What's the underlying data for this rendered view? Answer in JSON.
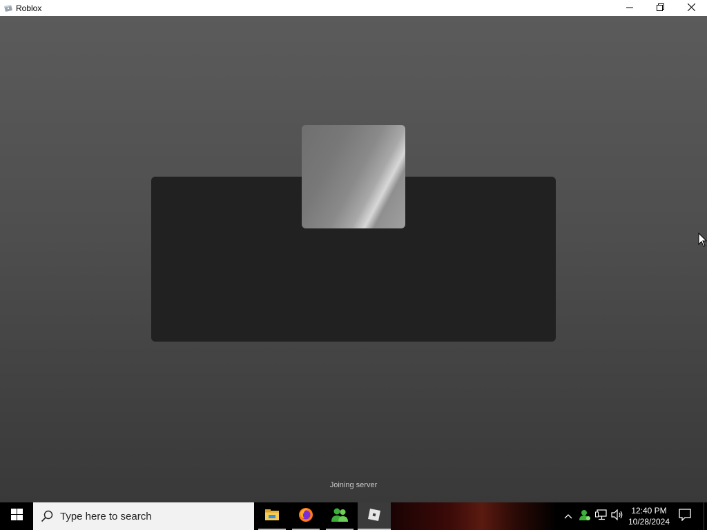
{
  "window": {
    "title": "Roblox",
    "icon": "roblox-window-icon",
    "controls": [
      "minimize-icon",
      "restore-icon",
      "close-icon"
    ]
  },
  "game": {
    "status": "Joining server",
    "thumbnail": "game-thumbnail-placeholder"
  },
  "taskbar": {
    "start_icon": "windows-logo-icon",
    "search_placeholder": "Type here to search",
    "apps": [
      {
        "name": "File Explorer",
        "icon": "folder-icon"
      },
      {
        "name": "Firefox",
        "icon": "firefox-icon"
      },
      {
        "name": "People",
        "icon": "people-icon"
      },
      {
        "name": "Roblox",
        "icon": "roblox-icon",
        "active": true
      }
    ],
    "tray": {
      "icons": [
        "chevron-up-icon",
        "user-status-icon",
        "network-icon",
        "volume-icon"
      ],
      "time": "12:40 PM",
      "date": "10/28/2024"
    }
  },
  "colors": {
    "viewport_top": "#5b5b5b",
    "viewport_bottom": "#393939",
    "panel": "#212121",
    "status_text": "#c8c8c8",
    "taskbar": "#000000",
    "search_box": "#f2f2f2"
  }
}
